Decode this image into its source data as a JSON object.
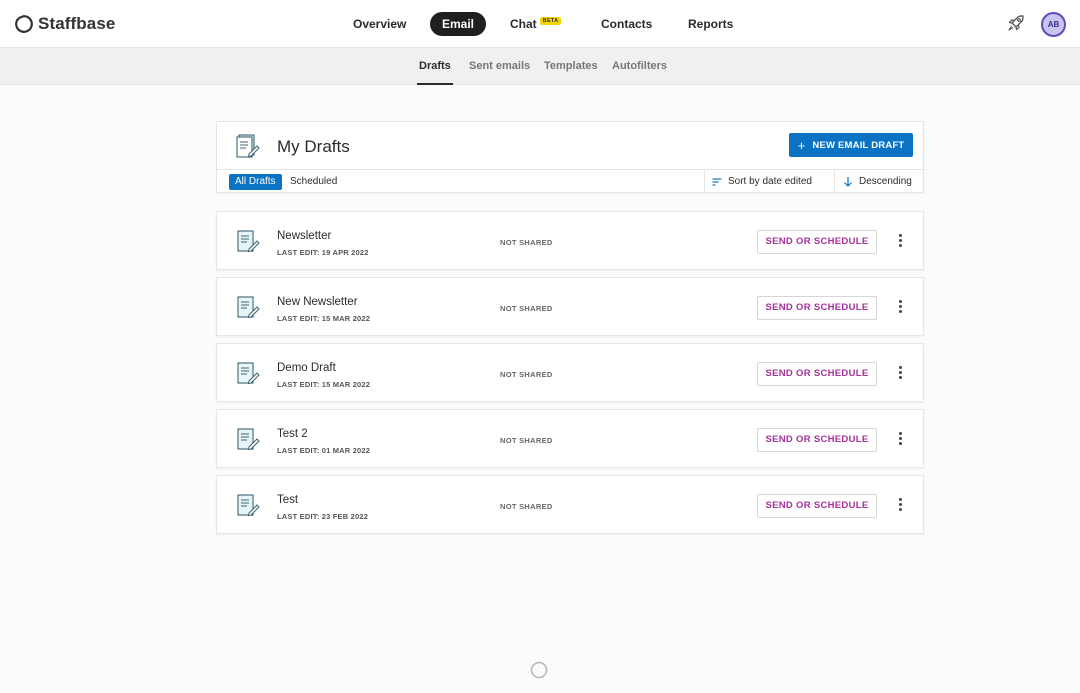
{
  "app": {
    "name": "Staffbase",
    "user_initials": "AB"
  },
  "main_nav": [
    {
      "label": "Overview",
      "active": false
    },
    {
      "label": "Email",
      "active": true
    },
    {
      "label": "Chat",
      "badge": "BETA",
      "active": false
    },
    {
      "label": "Contacts",
      "active": false
    },
    {
      "label": "Reports",
      "active": false
    }
  ],
  "sub_nav": [
    {
      "label": "Drafts",
      "active": true
    },
    {
      "label": "Sent emails",
      "active": false
    },
    {
      "label": "Templates",
      "active": false
    },
    {
      "label": "Autofilters",
      "active": false
    }
  ],
  "header": {
    "title": "My Drafts",
    "new_button": "NEW EMAIL DRAFT",
    "filters": {
      "all": "All Drafts",
      "scheduled": "Scheduled"
    },
    "sort_label": "Sort by date edited",
    "order_label": "Descending"
  },
  "drafts": [
    {
      "name": "Newsletter",
      "last_edit": "LAST EDIT: 19 APR 2022",
      "shared": "NOT SHARED",
      "action": "SEND OR SCHEDULE"
    },
    {
      "name": "New Newsletter",
      "last_edit": "LAST EDIT: 15 MAR 2022",
      "shared": "NOT SHARED",
      "action": "SEND OR SCHEDULE"
    },
    {
      "name": "Demo Draft",
      "last_edit": "LAST EDIT: 15 MAR 2022",
      "shared": "NOT SHARED",
      "action": "SEND OR SCHEDULE"
    },
    {
      "name": "Test 2",
      "last_edit": "LAST EDIT: 01 MAR 2022",
      "shared": "NOT SHARED",
      "action": "SEND OR SCHEDULE"
    },
    {
      "name": "Test",
      "last_edit": "LAST EDIT: 23 FEB 2022",
      "shared": "NOT SHARED",
      "action": "SEND OR SCHEDULE"
    }
  ],
  "colors": {
    "primary": "#0a73c4",
    "action_text": "#a5319a",
    "nav_active_bg": "#1f1f1f",
    "beta_badge": "#f5d30c",
    "avatar_bg": "#c9c3ef"
  },
  "icons": {
    "logo": "staffbase-logo-icon",
    "rocket": "rocket-icon",
    "document": "document-edit-icon",
    "sort": "sort-lines-icon",
    "order": "arrow-down-icon",
    "more": "kebab-menu-icon",
    "loading": "loading-spinner-icon"
  }
}
